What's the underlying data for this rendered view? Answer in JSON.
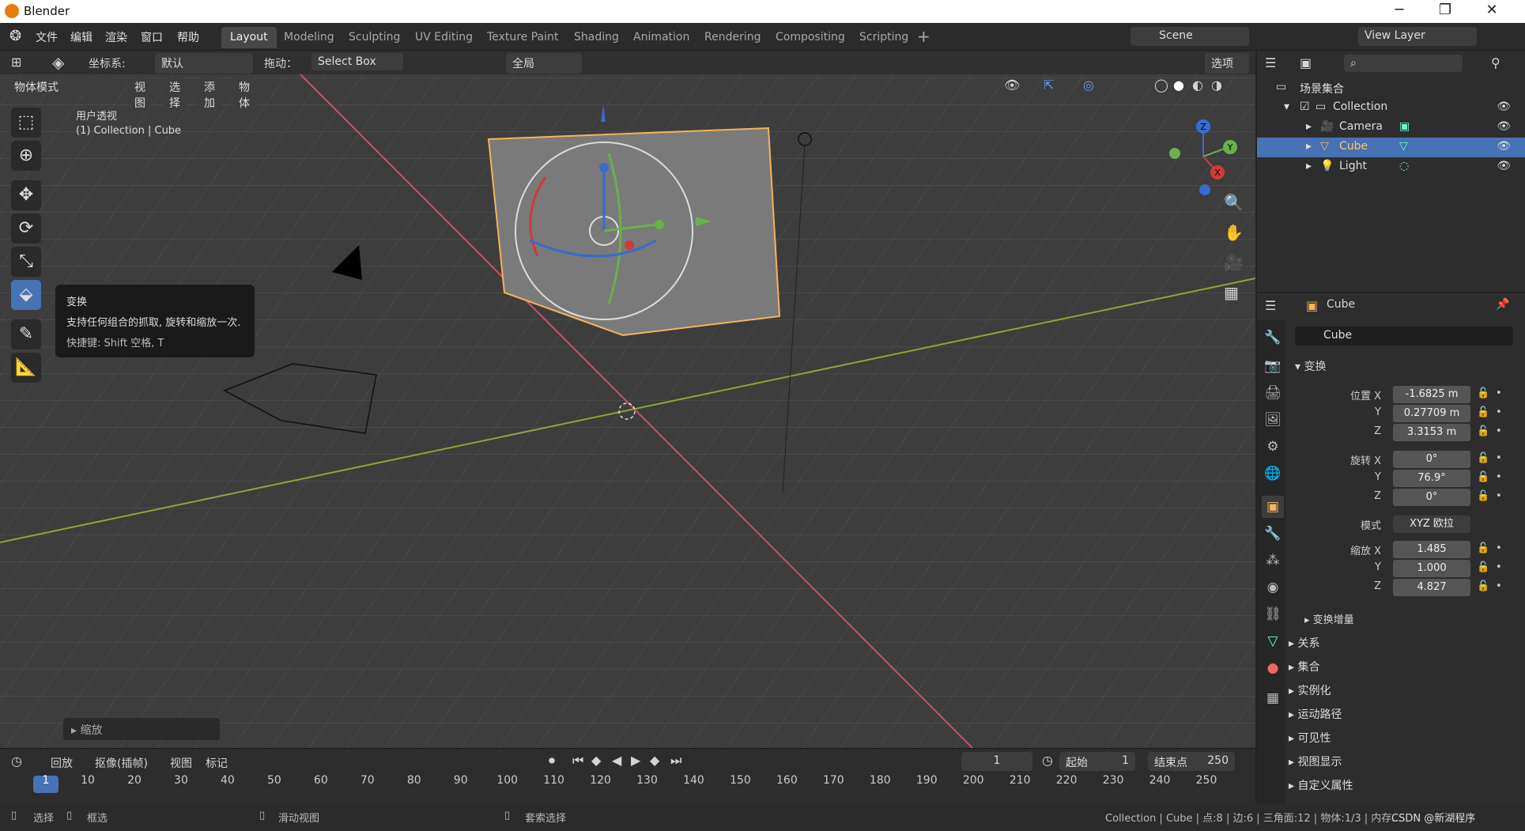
{
  "window": {
    "title": "Blender"
  },
  "menu": [
    "文件",
    "编辑",
    "渲染",
    "窗口",
    "帮助"
  ],
  "workspaces": [
    "Layout",
    "Modeling",
    "Sculpting",
    "UV Editing",
    "Texture Paint",
    "Shading",
    "Animation",
    "Rendering",
    "Compositing",
    "Scripting"
  ],
  "scene": {
    "name": "Scene",
    "view_layer": "View Layer"
  },
  "header": {
    "coord_label": "坐标系:",
    "coord_value": "默认",
    "drag_label": "拖动：",
    "drag_value": "Select Box",
    "global": "全局",
    "options": "选项"
  },
  "viewport_header": {
    "mode": "物体模式",
    "items": [
      "视图",
      "选择",
      "添加",
      "物体"
    ]
  },
  "viewport": {
    "view_name": "用户透视",
    "context": "(1) Collection | Cube",
    "gizmo": {
      "x": "X",
      "y": "Y",
      "z": "Z"
    }
  },
  "tooltip": {
    "title": "变换",
    "desc": "支持任何组合的抓取, 旋转和缩放一次.",
    "shortcut": "快捷键: Shift 空格, T"
  },
  "last_op": "缩放",
  "timeline": {
    "playback": "回放",
    "keying": "抠像(插帧)",
    "view": "视图",
    "marker": "标记",
    "current": "1",
    "start_label": "起始",
    "start": "1",
    "end_label": "结束点",
    "end": "250",
    "ticks": [
      "1",
      "10",
      "20",
      "30",
      "40",
      "50",
      "60",
      "70",
      "80",
      "90",
      "100",
      "110",
      "120",
      "130",
      "140",
      "150",
      "160",
      "170",
      "180",
      "190",
      "200",
      "210",
      "220",
      "230",
      "240",
      "250"
    ]
  },
  "statusbar": {
    "select": "选择",
    "box": "框选",
    "pan": "滑动视图",
    "lasso": "套索选择",
    "info": "Collection | Cube | 点:8 | 边:6 | 三角面:12 | 物体:1/3 | 内存...",
    "watermark": "CSDN @新湖程序"
  },
  "outliner": {
    "root": "场景集合",
    "collection": "Collection",
    "items": [
      "Camera",
      "Cube",
      "Light"
    ]
  },
  "properties": {
    "object": "Cube",
    "name_field": "Cube",
    "transform": "变换",
    "location": {
      "label": "位置 X",
      "x": "-1.6825 m",
      "y": "0.27709 m",
      "z": "3.3153 m"
    },
    "rotation": {
      "label": "旋转 X",
      "x": "0°",
      "y": "76.9°",
      "z": "0°"
    },
    "mode_label": "模式",
    "mode": "XYZ 欧拉",
    "scale": {
      "label": "缩放 X",
      "x": "1.485",
      "y": "1.000",
      "z": "4.827"
    },
    "y": "Y",
    "z": "Z",
    "sub": "变换增量",
    "sections": [
      "关系",
      "集合",
      "实例化",
      "运动路径",
      "可见性",
      "视图显示",
      "自定义属性"
    ]
  },
  "colors": {
    "accent": "#4772b3",
    "selected_orange": "#f4b35c"
  }
}
